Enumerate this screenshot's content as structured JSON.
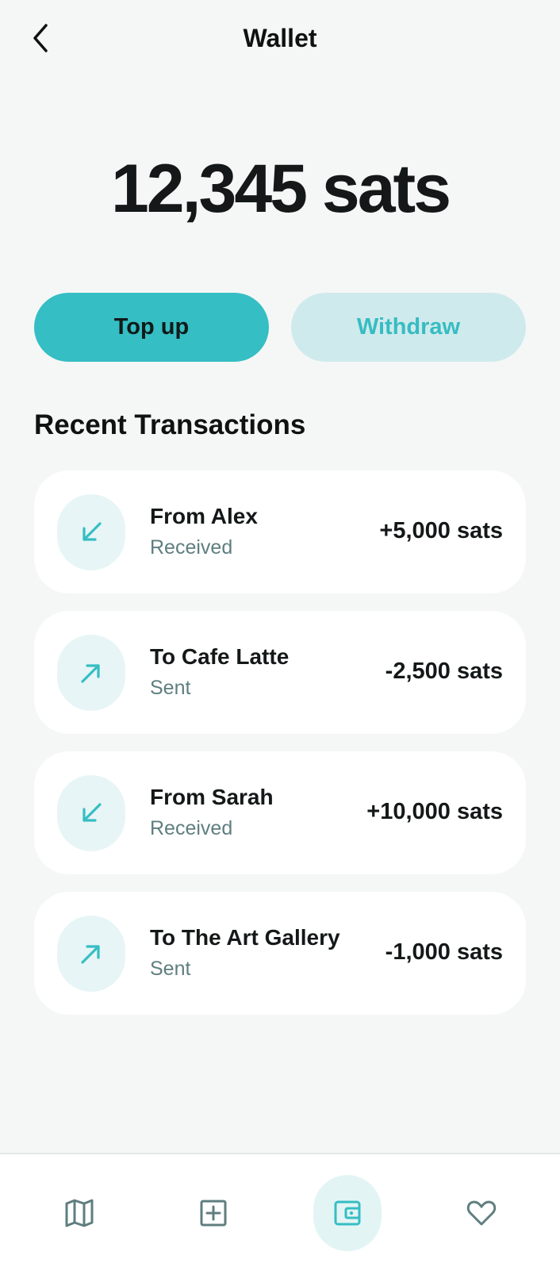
{
  "header": {
    "title": "Wallet",
    "back_icon": "chevron-left-icon"
  },
  "balance": {
    "amount": "12,345 sats"
  },
  "actions": {
    "top_up_label": "Top up",
    "withdraw_label": "Withdraw"
  },
  "transactions": {
    "section_title": "Recent Transactions",
    "items": [
      {
        "name": "From Alex",
        "status": "Received",
        "amount": "+5,000 sats",
        "icon": "arrow-down-left-icon"
      },
      {
        "name": "To Cafe Latte",
        "status": "Sent",
        "amount": "-2,500 sats",
        "icon": "arrow-up-right-icon"
      },
      {
        "name": "From Sarah",
        "status": "Received",
        "amount": "+10,000 sats",
        "icon": "arrow-down-left-icon"
      },
      {
        "name": "To The Art Gallery",
        "status": "Sent",
        "amount": "-1,000 sats",
        "icon": "arrow-up-right-icon"
      }
    ]
  },
  "bottom_nav": {
    "items": [
      {
        "icon": "map-icon",
        "active": false
      },
      {
        "icon": "add-square-icon",
        "active": false
      },
      {
        "icon": "wallet-icon",
        "active": true
      },
      {
        "icon": "heart-icon",
        "active": false
      }
    ]
  },
  "colors": {
    "accent": "#35bec3",
    "accent_light": "#cfeaec",
    "background": "#f5f7f6",
    "muted_text": "#5f7e80"
  }
}
